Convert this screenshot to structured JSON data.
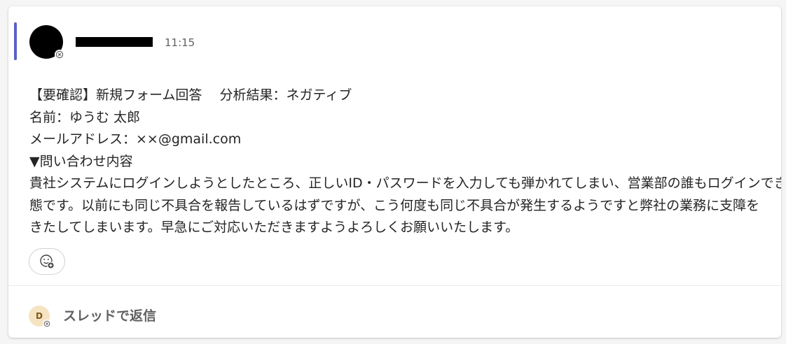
{
  "message": {
    "timestamp": "11:15",
    "lines": [
      "【要確認】新規フォーム回答　 分析結果：ネガティブ",
      "名前：ゆうむ 太郎",
      "メールアドレス：××@gmail.com",
      "▼問い合わせ内容",
      "貴社システムにログインしようとしたところ、正しいID・パスワードを入力しても弾かれてしまい、営業部の誰もログインできない状",
      "態です。以前にも同じ不具合を報告しているはずですが、こう何度も同じ不具合が発生するようですと弊社の業務に支障を",
      "きたしてしまいます。早急にご対応いただきますようよろしくお願いいたします。"
    ],
    "accent_color": "#5b5fc7",
    "sender_name": "[redacted]"
  },
  "reactions": {
    "add_icon": "emoji-add-icon"
  },
  "reply": {
    "avatar_initial": "D",
    "label": "スレッドで返信"
  }
}
